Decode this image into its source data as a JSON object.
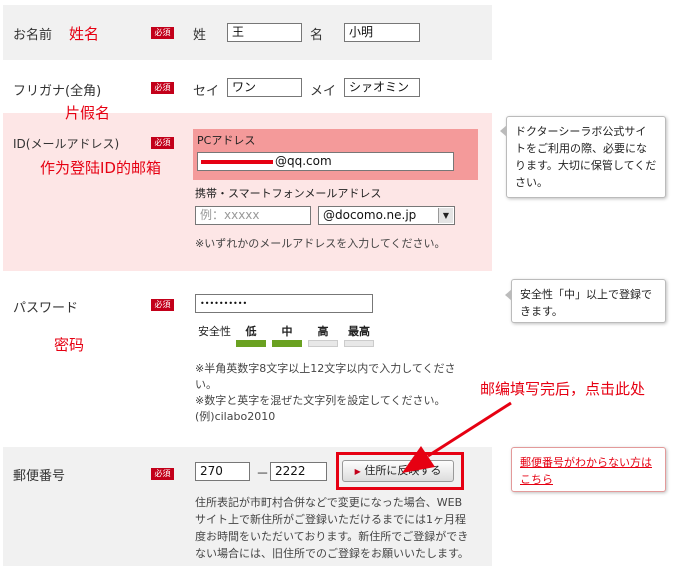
{
  "colors": {
    "required_badge": "#c3001a",
    "annotation_red": "#e60012",
    "highlight_pink": "#fde6e6",
    "pc_box": "#f49a9a",
    "strength_on": "#6aa121",
    "strength_off": "#e8e8e8"
  },
  "name_row": {
    "label": "お名前",
    "annotation": "姓名",
    "badge": "必須",
    "sei_label": "姓",
    "sei_value": "王",
    "mei_label": "名",
    "mei_value": "小明"
  },
  "furigana_row": {
    "label": "フリガナ(全角)",
    "annotation": "片假名",
    "badge": "必須",
    "sei_label": "セイ",
    "sei_value": "ワン",
    "mei_label": "メイ",
    "mei_value": "シァオミン"
  },
  "email_row": {
    "label": "ID(メールアドレス)",
    "annotation": "作为登陆ID的邮箱",
    "badge": "必須",
    "pc_label": "PCアドレス",
    "pc_value": "@qq.com",
    "mobile_label": "携帯・スマートフォンメールアドレス",
    "mobile_placeholder": "例：xxxxx",
    "domain_select": "@docomo.ne.jp",
    "note": "※いずれかのメールアドレスを入力してください。",
    "help": "ドクターシーラボ公式サイトをご利用の際、必要になります。大切に保管してください。"
  },
  "password_row": {
    "label": "パスワード",
    "annotation": "密码",
    "badge": "必須",
    "value": "••••••••••",
    "strength_label": "安全性",
    "strength_levels": [
      "低",
      "中",
      "高",
      "最高"
    ],
    "strength_value": 0.5,
    "notes": [
      "※半角英数字8文字以上12文字以内で入力してくださ",
      "い。",
      "※数字と英字を混ぜた文字列を設定してください。",
      "(例)cilabo2010"
    ],
    "help": "安全性「中」以上で登録できます。"
  },
  "postal_row": {
    "label": "郵便番号",
    "badge": "必須",
    "zip1": "270",
    "separator": "－",
    "zip2": "2222",
    "button": "住所に反映する",
    "annotation": "邮编填写完后，点击此处",
    "notes": [
      "住所表記が市町村合併などで変更になった場合、WEB",
      "サイト上で新住所がご登録いただけるまでには1ヶ月程",
      "度お時間をいただいております。新住所でご登録ができ",
      "ない場合には、旧住所でのご登録をお願いいたします。"
    ],
    "help_link": "郵便番号がわからない方はこちら"
  }
}
